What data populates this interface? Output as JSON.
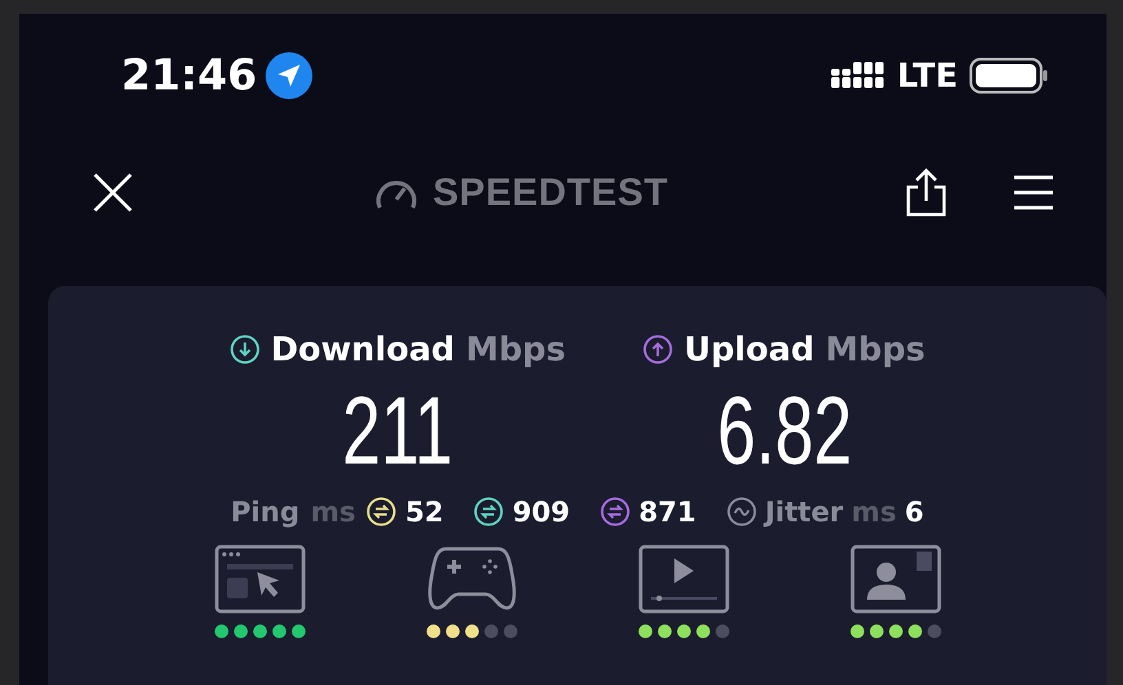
{
  "status_bar": {
    "time": "21:46",
    "network": "LTE"
  },
  "toolbar": {
    "logo": "SPEEDTEST"
  },
  "metrics": [
    {
      "kind": "download",
      "label": "Download",
      "unit": "Mbps",
      "value": "211"
    },
    {
      "kind": "upload",
      "label": "Upload",
      "unit": "Mbps",
      "value": "6.82"
    }
  ],
  "ping": {
    "label": "Ping",
    "unit": "ms",
    "values": [
      {
        "kind": "idle",
        "value": "52"
      },
      {
        "kind": "download",
        "value": "909"
      },
      {
        "kind": "upload",
        "value": "871"
      }
    ]
  },
  "jitter": {
    "label": "Jitter",
    "unit": "ms",
    "value": "6"
  },
  "ratings": [
    {
      "kind": "browsing",
      "stars": 5,
      "color": "#22c76e"
    },
    {
      "kind": "gaming",
      "stars": 3,
      "color": "#f0e08a"
    },
    {
      "kind": "streaming",
      "stars": 4,
      "color": "#8de05c"
    },
    {
      "kind": "video_call",
      "stars": 4,
      "color": "#8de05c"
    }
  ]
}
